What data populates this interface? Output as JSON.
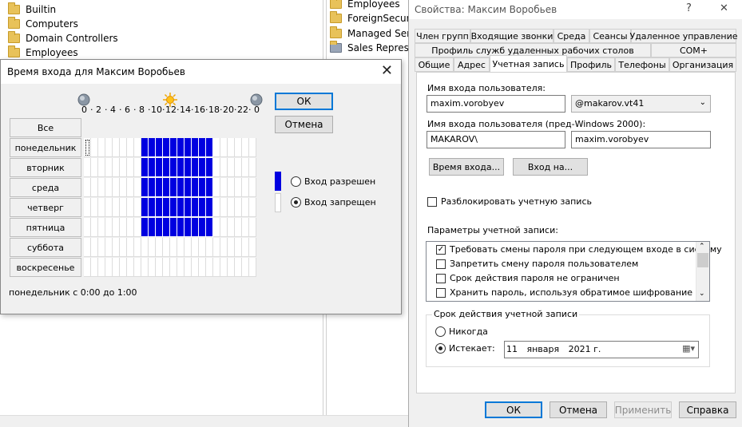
{
  "background_tree": {
    "left_items": [
      "Builtin",
      "Computers",
      "Domain Controllers",
      "Employees"
    ],
    "right_items": [
      "Employees",
      "ForeignSecurity",
      "Managed Servi",
      "Sales Represent"
    ]
  },
  "logon_dialog": {
    "title": "Время входа для Максим Воробьев",
    "close": "✕",
    "hour_labels": [
      "0",
      "2",
      "4",
      "6",
      "8",
      "10",
      "12",
      "14",
      "16",
      "18",
      "20",
      "22",
      "0"
    ],
    "all_label": "Все",
    "days": [
      "понедельник",
      "вторник",
      "среда",
      "четверг",
      "пятница",
      "суббота",
      "воскресенье"
    ],
    "permitted_hours_weekdays": [
      8,
      9,
      10,
      11,
      12,
      13,
      14,
      15,
      16,
      17
    ],
    "ok": "ОК",
    "cancel": "Отмена",
    "allowed_label": "Вход разрешен",
    "denied_label": "Вход запрещен",
    "selected_radio": "denied",
    "allowed_color": "#0000e0",
    "status": "понедельник с 0:00 до 1:00"
  },
  "props": {
    "title": "Свойства: Максим Воробьев",
    "help": "?",
    "close": "✕",
    "tabs_row1": [
      "Член групп",
      "Входящие звонки",
      "Среда",
      "Сеансы",
      "Удаленное управление"
    ],
    "tabs_row2": [
      "Профиль служб удаленных рабочих столов",
      "COM+"
    ],
    "tabs_row3": [
      "Общие",
      "Адрес",
      "Учетная запись",
      "Профиль",
      "Телефоны",
      "Организация"
    ],
    "active_tab": "Учетная запись",
    "logon_name_label": "Имя входа пользователя:",
    "logon_name": "maxim.vorobyev",
    "domain_suffix": "@makarov.vt41",
    "pre2000_label": "Имя входа пользователя (пред-Windows 2000):",
    "pre2000_domain": "MAKAROV\\",
    "pre2000_name": "maxim.vorobyev",
    "logon_hours_button": "Время входа...",
    "logon_to_button": "Вход на...",
    "unlock_label": "Разблокировать учетную запись",
    "options_label": "Параметры учетной записи:",
    "options": [
      {
        "label": "Требовать смены пароля при следующем входе в систему",
        "checked": true
      },
      {
        "label": "Запретить смену пароля пользователем",
        "checked": false
      },
      {
        "label": "Срок действия пароля не ограничен",
        "checked": false
      },
      {
        "label": "Хранить пароль, используя обратимое шифрование",
        "checked": false
      }
    ],
    "expiry_group": "Срок действия учетной записи",
    "never_label": "Никогда",
    "expires_label": "Истекает:",
    "expiry_selected": "expires",
    "expiry_day": "11",
    "expiry_month": "января",
    "expiry_year": "2021 г.",
    "ok": "ОК",
    "cancel": "Отмена",
    "apply": "Применить",
    "help_button": "Справка"
  }
}
